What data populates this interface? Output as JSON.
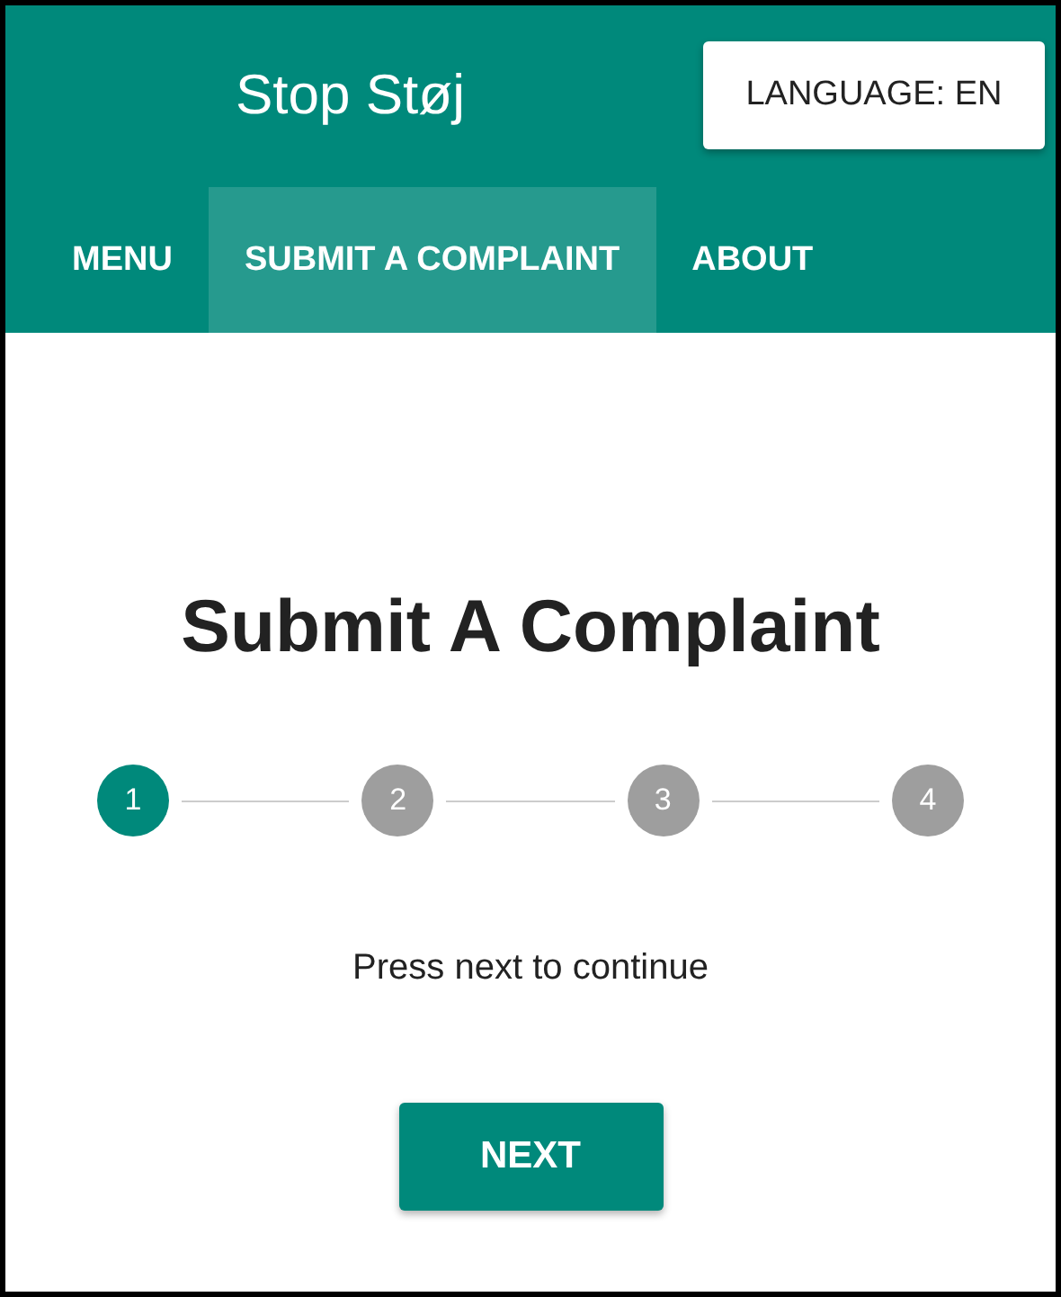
{
  "app_bar": {
    "title": "Stop Støj",
    "language_button": "LANGUAGE: EN"
  },
  "tabs": [
    {
      "label": "MENU",
      "selected": false
    },
    {
      "label": "SUBMIT A COMPLAINT",
      "selected": true
    },
    {
      "label": "ABOUT",
      "selected": false
    }
  ],
  "heading": "Submit A Complaint",
  "steps": [
    {
      "label": "1",
      "selected": true
    },
    {
      "label": "2",
      "selected": false
    },
    {
      "label": "3",
      "selected": false
    },
    {
      "label": "4",
      "selected": false
    }
  ],
  "message": "Press next to continue",
  "next_button": "NEXT"
}
